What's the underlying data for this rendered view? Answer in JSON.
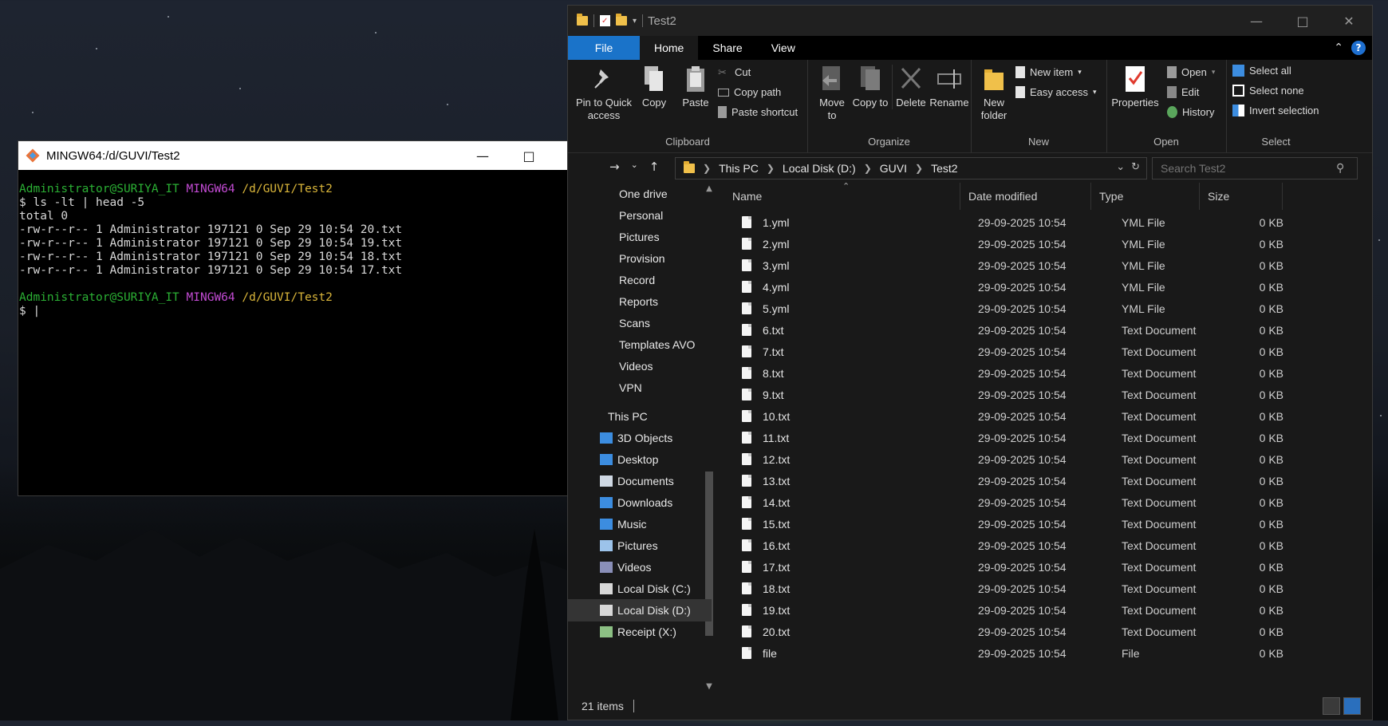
{
  "terminal": {
    "title": "MINGW64:/d/GUVI/Test2",
    "prompt_user": "Administrator@SURIYA_IT",
    "prompt_env": "MINGW64",
    "prompt_path": "/d/GUVI/Test2",
    "command": "$ ls -lt | head -5",
    "output": [
      "total 0",
      "-rw-r--r-- 1 Administrator 197121 0 Sep 29 10:54 20.txt",
      "-rw-r--r-- 1 Administrator 197121 0 Sep 29 10:54 19.txt",
      "-rw-r--r-- 1 Administrator 197121 0 Sep 29 10:54 18.txt",
      "-rw-r--r-- 1 Administrator 197121 0 Sep 29 10:54 17.txt"
    ],
    "prompt2_symbol": "$ |"
  },
  "explorer": {
    "title": "Test2",
    "tabs": [
      "File",
      "Home",
      "Share",
      "View"
    ],
    "ribbon": {
      "clipboard": {
        "label": "Clipboard",
        "pin": "Pin to Quick access",
        "copy": "Copy",
        "paste": "Paste",
        "cut": "Cut",
        "copy_path": "Copy path",
        "paste_shortcut": "Paste shortcut"
      },
      "organize": {
        "label": "Organize",
        "move_to": "Move to",
        "copy_to": "Copy to",
        "delete": "Delete",
        "rename": "Rename"
      },
      "new": {
        "label": "New",
        "new_folder": "New folder",
        "new_item": "New item",
        "easy_access": "Easy access"
      },
      "open": {
        "label": "Open",
        "properties": "Properties",
        "open": "Open",
        "edit": "Edit",
        "history": "History"
      },
      "select": {
        "label": "Select",
        "select_all": "Select all",
        "select_none": "Select none",
        "invert": "Invert selection"
      }
    },
    "breadcrumb": [
      "This PC",
      "Local Disk (D:)",
      "GUVI",
      "Test2"
    ],
    "search_placeholder": "Search Test2",
    "nav_items": [
      {
        "label": "One drive",
        "icon": "none"
      },
      {
        "label": "Personal",
        "icon": "none"
      },
      {
        "label": "Pictures",
        "icon": "none"
      },
      {
        "label": "Provision",
        "icon": "none"
      },
      {
        "label": "Record",
        "icon": "none"
      },
      {
        "label": "Reports",
        "icon": "none"
      },
      {
        "label": "Scans",
        "icon": "none"
      },
      {
        "label": "Templates AVO",
        "icon": "none"
      },
      {
        "label": "Videos",
        "icon": "none"
      },
      {
        "label": "VPN",
        "icon": "none"
      },
      {
        "label": "This PC",
        "icon": "none"
      },
      {
        "label": "3D Objects",
        "icon": "3d-objects-icon"
      },
      {
        "label": "Desktop",
        "icon": "desktop-icon"
      },
      {
        "label": "Documents",
        "icon": "documents-icon"
      },
      {
        "label": "Downloads",
        "icon": "downloads-icon"
      },
      {
        "label": "Music",
        "icon": "music-icon"
      },
      {
        "label": "Pictures",
        "icon": "pictures-icon"
      },
      {
        "label": "Videos",
        "icon": "videos-icon"
      },
      {
        "label": "Local Disk (C:)",
        "icon": "drive-icon"
      },
      {
        "label": "Local Disk (D:)",
        "icon": "drive-icon"
      },
      {
        "label": "Receipt  (X:)",
        "icon": "network-drive-icon"
      }
    ],
    "columns": [
      "Name",
      "Date modified",
      "Type",
      "Size"
    ],
    "files": [
      {
        "name": "1.yml",
        "date": "29-09-2025 10:54",
        "type": "YML File",
        "size": "0 KB"
      },
      {
        "name": "2.yml",
        "date": "29-09-2025 10:54",
        "type": "YML File",
        "size": "0 KB"
      },
      {
        "name": "3.yml",
        "date": "29-09-2025 10:54",
        "type": "YML File",
        "size": "0 KB"
      },
      {
        "name": "4.yml",
        "date": "29-09-2025 10:54",
        "type": "YML File",
        "size": "0 KB"
      },
      {
        "name": "5.yml",
        "date": "29-09-2025 10:54",
        "type": "YML File",
        "size": "0 KB"
      },
      {
        "name": "6.txt",
        "date": "29-09-2025 10:54",
        "type": "Text Document",
        "size": "0 KB"
      },
      {
        "name": "7.txt",
        "date": "29-09-2025 10:54",
        "type": "Text Document",
        "size": "0 KB"
      },
      {
        "name": "8.txt",
        "date": "29-09-2025 10:54",
        "type": "Text Document",
        "size": "0 KB"
      },
      {
        "name": "9.txt",
        "date": "29-09-2025 10:54",
        "type": "Text Document",
        "size": "0 KB"
      },
      {
        "name": "10.txt",
        "date": "29-09-2025 10:54",
        "type": "Text Document",
        "size": "0 KB"
      },
      {
        "name": "11.txt",
        "date": "29-09-2025 10:54",
        "type": "Text Document",
        "size": "0 KB"
      },
      {
        "name": "12.txt",
        "date": "29-09-2025 10:54",
        "type": "Text Document",
        "size": "0 KB"
      },
      {
        "name": "13.txt",
        "date": "29-09-2025 10:54",
        "type": "Text Document",
        "size": "0 KB"
      },
      {
        "name": "14.txt",
        "date": "29-09-2025 10:54",
        "type": "Text Document",
        "size": "0 KB"
      },
      {
        "name": "15.txt",
        "date": "29-09-2025 10:54",
        "type": "Text Document",
        "size": "0 KB"
      },
      {
        "name": "16.txt",
        "date": "29-09-2025 10:54",
        "type": "Text Document",
        "size": "0 KB"
      },
      {
        "name": "17.txt",
        "date": "29-09-2025 10:54",
        "type": "Text Document",
        "size": "0 KB"
      },
      {
        "name": "18.txt",
        "date": "29-09-2025 10:54",
        "type": "Text Document",
        "size": "0 KB"
      },
      {
        "name": "19.txt",
        "date": "29-09-2025 10:54",
        "type": "Text Document",
        "size": "0 KB"
      },
      {
        "name": "20.txt",
        "date": "29-09-2025 10:54",
        "type": "Text Document",
        "size": "0 KB"
      },
      {
        "name": "file",
        "date": "29-09-2025 10:54",
        "type": "File",
        "size": "0 KB"
      }
    ],
    "status_count": "21 items"
  },
  "colors": {
    "accent": "#1a73c9",
    "term_green": "#2bb034",
    "term_magenta": "#c34bd4",
    "term_yellow": "#d9b53a"
  }
}
